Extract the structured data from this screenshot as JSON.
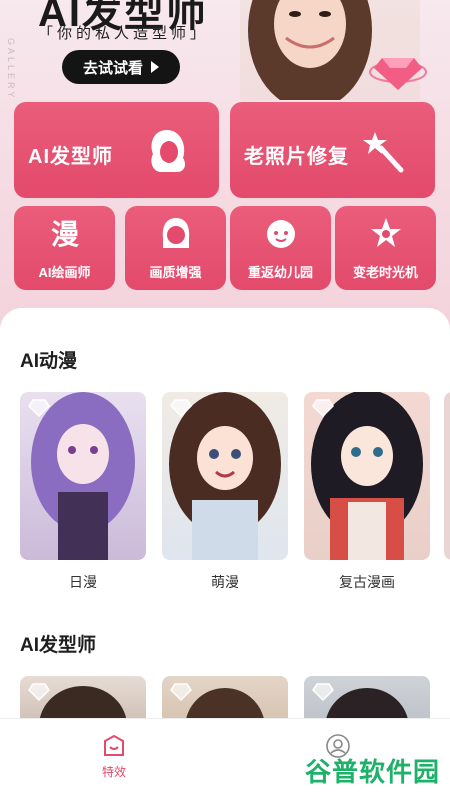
{
  "hero": {
    "title": "AI发型师",
    "subtitle": "「你的私人造型师」",
    "side_text": "GALLERY",
    "try_button": "去试试看"
  },
  "features_big": [
    {
      "label": "AI发型师",
      "icon": "hair-silhouette-icon"
    },
    {
      "label": "老照片修复",
      "icon": "magic-wand-icon"
    }
  ],
  "features_small": [
    {
      "label": "AI绘画师",
      "icon": "man-character-icon"
    },
    {
      "label": "画质增强",
      "icon": "girl-face-icon"
    },
    {
      "label": "重返幼儿园",
      "icon": "baby-face-icon"
    },
    {
      "label": "变老时光机",
      "icon": "star-icon"
    }
  ],
  "sections": [
    {
      "title": "AI动漫",
      "items": [
        "日漫",
        "萌漫",
        "复古漫画"
      ]
    },
    {
      "title": "AI发型师",
      "items": []
    }
  ],
  "bottom_nav": [
    {
      "label": "特效",
      "active": true
    },
    {
      "label": "",
      "active": false
    }
  ],
  "watermark": "谷普软件园",
  "colors": {
    "accent": "#e34a6b",
    "active_nav": "#e34a6b",
    "watermark": "#1fb06a"
  }
}
